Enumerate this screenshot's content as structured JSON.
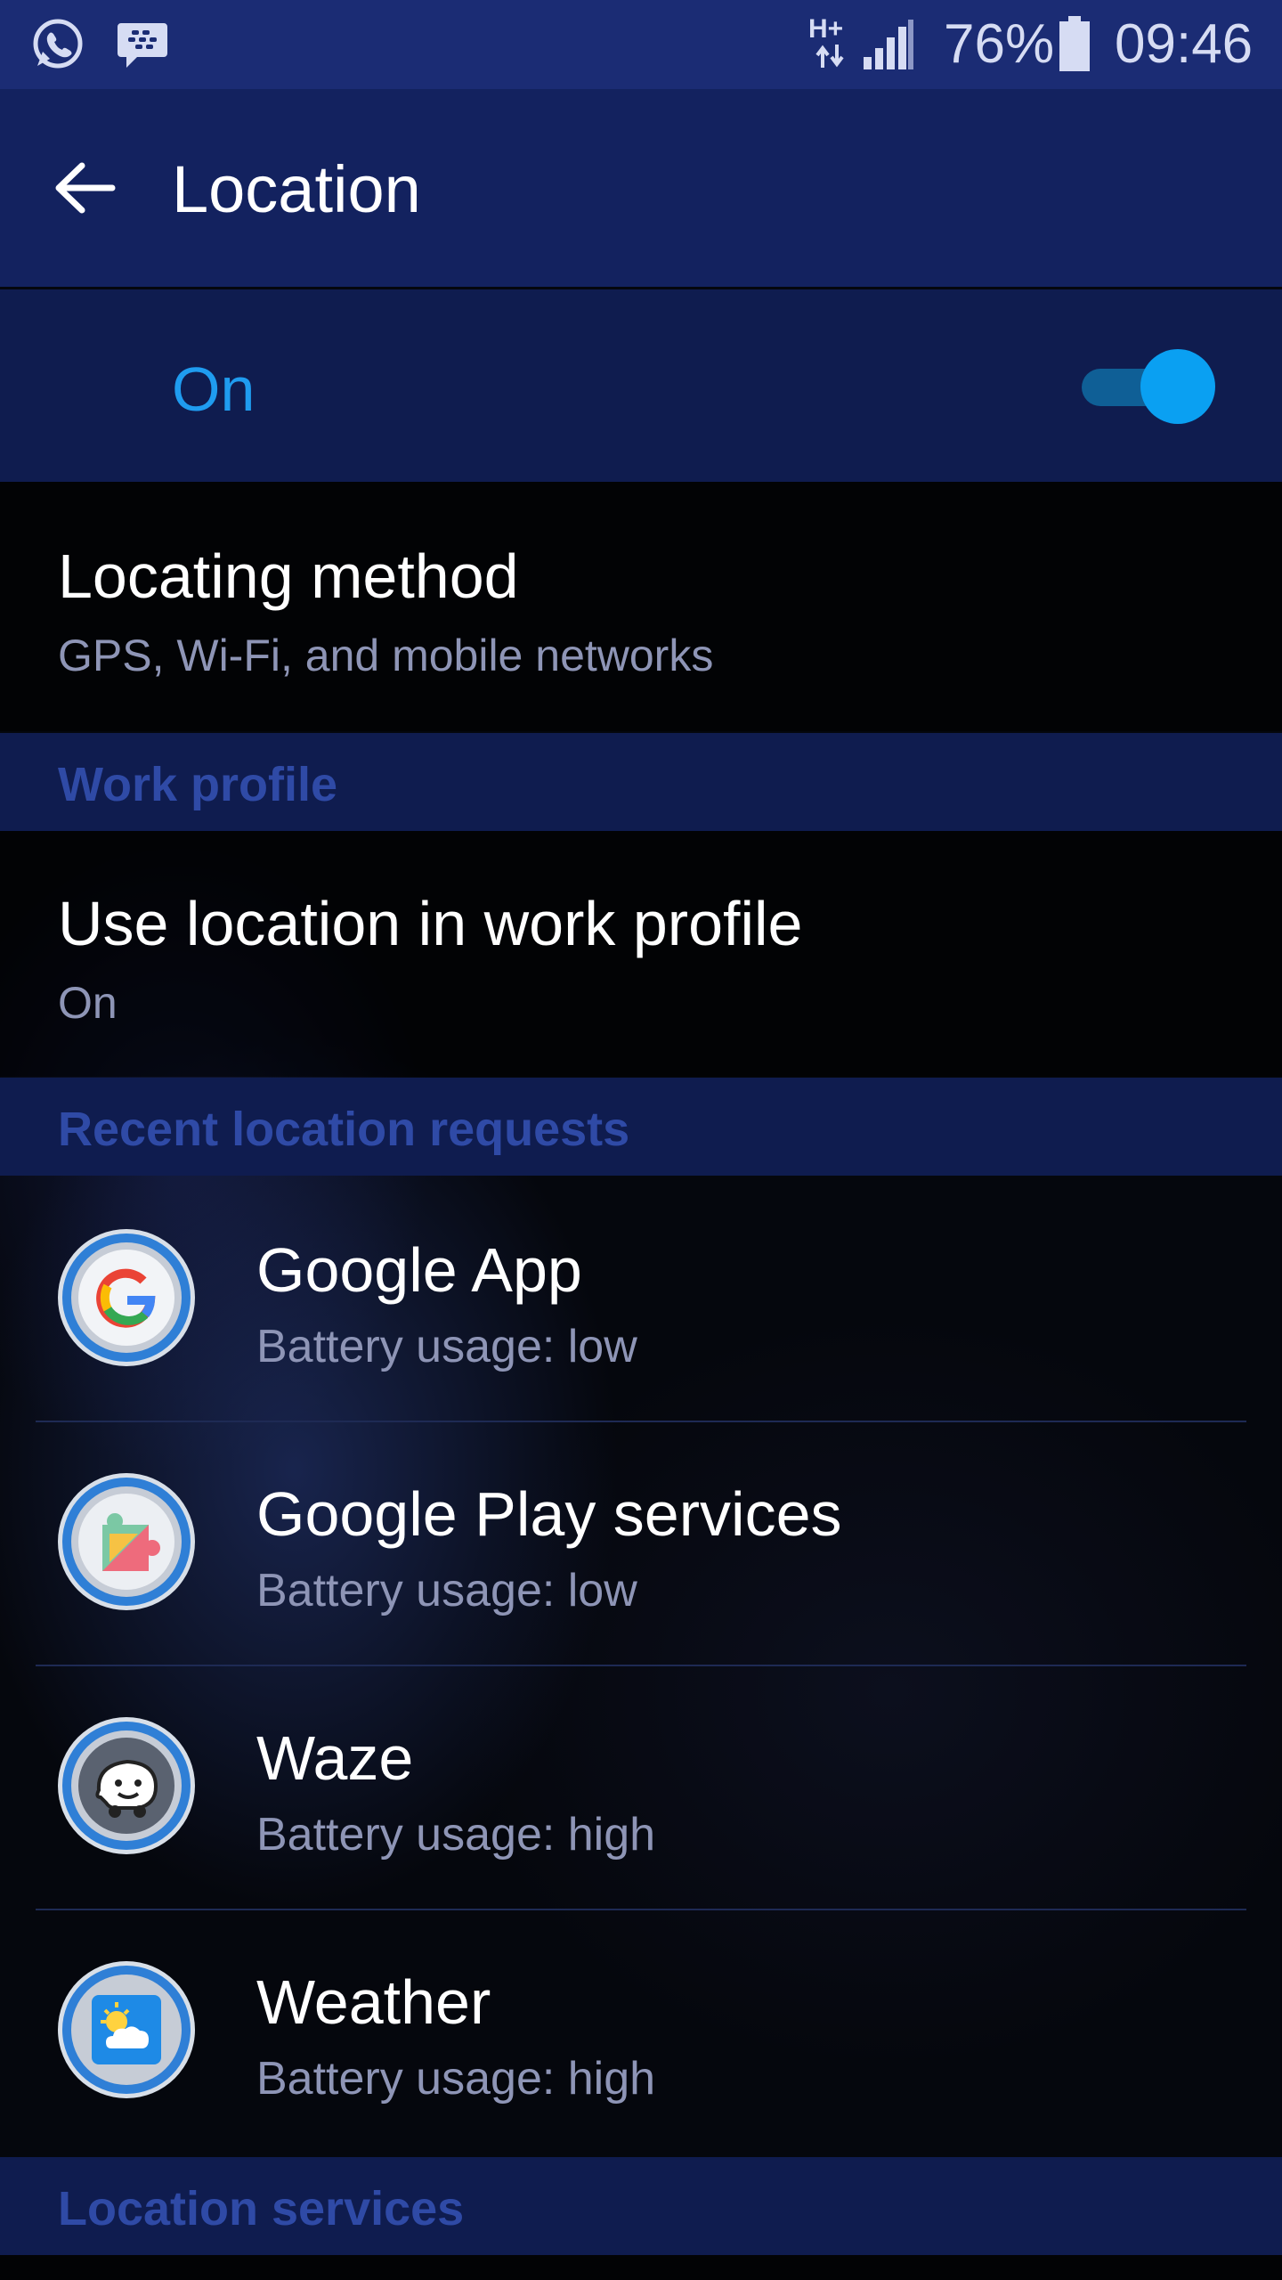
{
  "status_bar": {
    "network_type": "H+",
    "battery_percent": "76%",
    "time": "09:46",
    "left_icons": [
      "whatsapp-icon",
      "blackberry-messenger-icon"
    ],
    "right_icons": [
      "network-arrows-icon",
      "signal-icon",
      "battery-icon"
    ]
  },
  "app_bar": {
    "title": "Location",
    "back_icon": "arrow-left-icon"
  },
  "master_switch": {
    "label": "On",
    "state": true,
    "accent": "#1f9cf0"
  },
  "settings": {
    "locating_method": {
      "title": "Locating method",
      "summary": "GPS, Wi-Fi, and mobile networks"
    },
    "work_profile_header": "Work profile",
    "work_profile_location": {
      "title": "Use location in work profile",
      "summary": "On"
    },
    "recent_requests_header": "Recent location requests",
    "location_services_header": "Location services"
  },
  "recent_apps": [
    {
      "name": "Google App",
      "battery": "Battery usage: low",
      "icon": "google-g-icon"
    },
    {
      "name": "Google Play services",
      "battery": "Battery usage: low",
      "icon": "google-play-services-icon"
    },
    {
      "name": "Waze",
      "battery": "Battery usage: high",
      "icon": "waze-icon"
    },
    {
      "name": "Weather",
      "battery": "Battery usage: high",
      "icon": "weather-icon"
    }
  ],
  "colors": {
    "status_bar_bg": "#1b2c74",
    "app_bar_bg": "#13225f",
    "header_text": "#2f4aa6",
    "secondary_text": "#8e95b6"
  }
}
